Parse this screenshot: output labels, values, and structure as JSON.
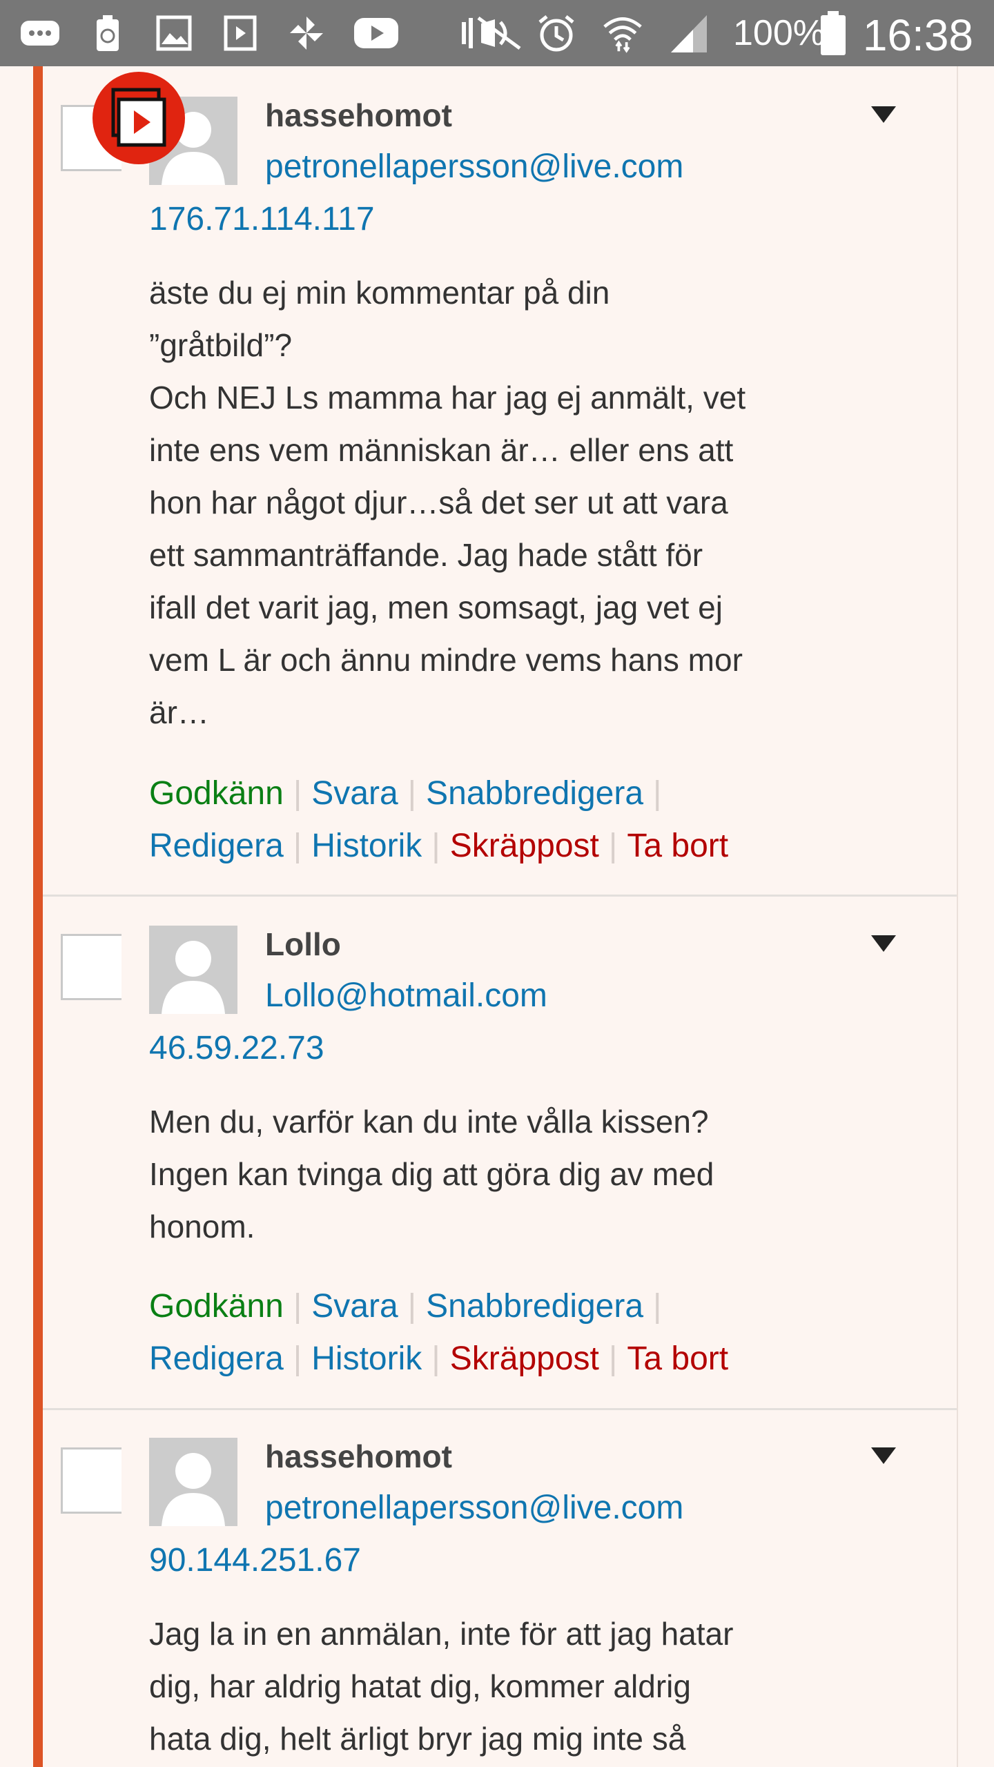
{
  "status_bar": {
    "battery_percent": "100%",
    "time": "16:38",
    "icons": [
      "message-icon",
      "recycle-icon",
      "gallery-icon",
      "video-icon",
      "pinwheel-icon",
      "youtube-icon",
      "mute-icon",
      "alarm-icon",
      "wifi-icon",
      "signal-icon",
      "battery-icon"
    ]
  },
  "comments": [
    {
      "author": "hassehomot",
      "email": "petronellapersson@live.com",
      "ip": "176.71.114.117",
      "body": [
        "äste du ej min kommentar på din",
        "”gråtbild”?",
        "Och NEJ Ls mamma har jag ej anmält, vet",
        "inte ens vem människan är… eller ens att",
        "hon har något djur…så det ser ut att vara",
        "ett sammanträffande. Jag hade stått för",
        "ifall det varit jag, men somsagt, jag vet ej",
        "vem L är och ännu mindre vems hans mor",
        "är…"
      ]
    },
    {
      "author": "Lollo",
      "email": "Lollo@hotmail.com",
      "ip": "46.59.22.73",
      "body": [
        "Men du, varför kan du inte vålla kissen?",
        "Ingen kan tvinga dig att göra dig av med",
        "honom."
      ]
    },
    {
      "author": "hassehomot",
      "email": "petronellapersson@live.com",
      "ip": "90.144.251.67",
      "body": [
        "Jag la in en anmälan, inte för att jag hatar",
        "dig, har aldrig hatat dig, kommer aldrig",
        "hata dig, helt ärligt bryr jag mig inte så"
      ]
    }
  ],
  "actions": {
    "approve": "Godkänn",
    "reply": "Svara",
    "quick_edit": "Snabbredigera",
    "edit": "Redigera",
    "history": "Historik",
    "spam": "Skräppost",
    "delete": "Ta bort"
  },
  "colors": {
    "accent": "#dd5426",
    "link": "#0f75b0",
    "approve": "#0a7f14",
    "danger": "#b30000",
    "background": "#fdf5f1"
  }
}
